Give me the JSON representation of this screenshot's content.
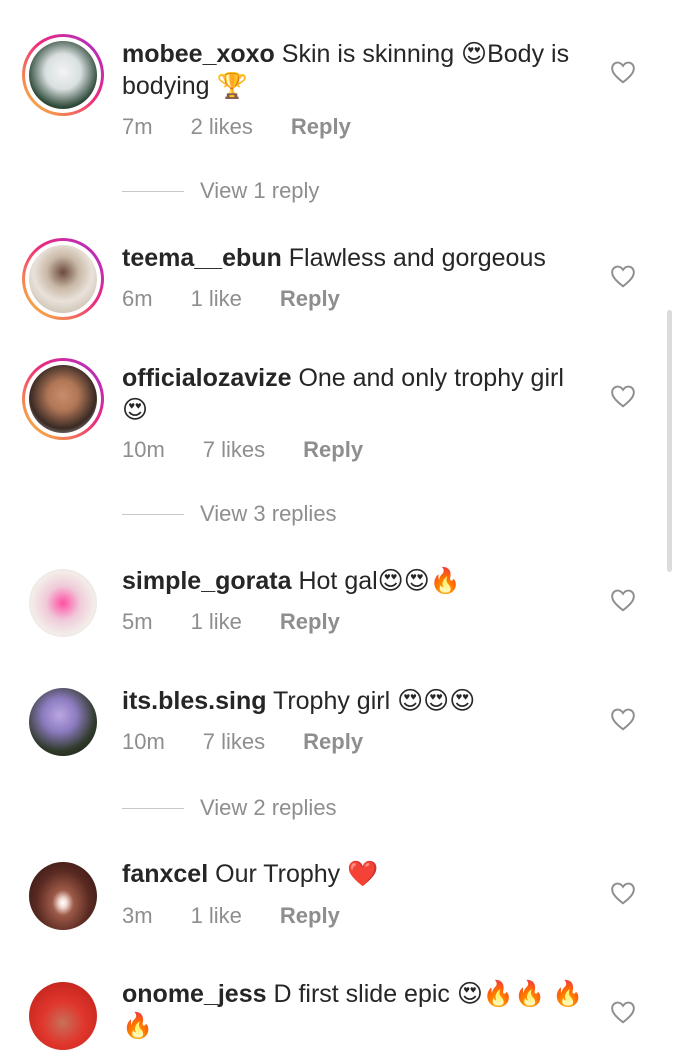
{
  "comments": [
    {
      "username": "mobee_xoxo",
      "text": "Skin is skinning 😍Body is bodying 🏆",
      "time": "7m",
      "likes": "2 likes",
      "reply": "Reply",
      "view_replies": "View 1 reply"
    },
    {
      "username": "teema__ebun",
      "text": "Flawless and gorgeous",
      "time": "6m",
      "likes": "1 like",
      "reply": "Reply"
    },
    {
      "username": "officialozavize",
      "text": "One and only trophy girl 😍",
      "time": "10m",
      "likes": "7 likes",
      "reply": "Reply",
      "view_replies": "View 3 replies"
    },
    {
      "username": "simple_gorata",
      "text": "Hot gal😍😍🔥",
      "time": "5m",
      "likes": "1 like",
      "reply": "Reply"
    },
    {
      "username": "its.bles.sing",
      "text": "Trophy girl 😍😍😍",
      "time": "10m",
      "likes": "7 likes",
      "reply": "Reply",
      "view_replies": "View 2 replies"
    },
    {
      "username": "fanxcel",
      "text": "Our Trophy ❤️",
      "time": "3m",
      "likes": "1 like",
      "reply": "Reply"
    },
    {
      "username": "onome_jess",
      "text": "D first slide epic 😍🔥🔥 🔥🔥"
    }
  ],
  "icons": {
    "like": "heart-outline-icon"
  },
  "colors": {
    "meta": "#8e8e8e",
    "ring_start": "#f9ce34",
    "ring_end": "#a12fd3"
  }
}
